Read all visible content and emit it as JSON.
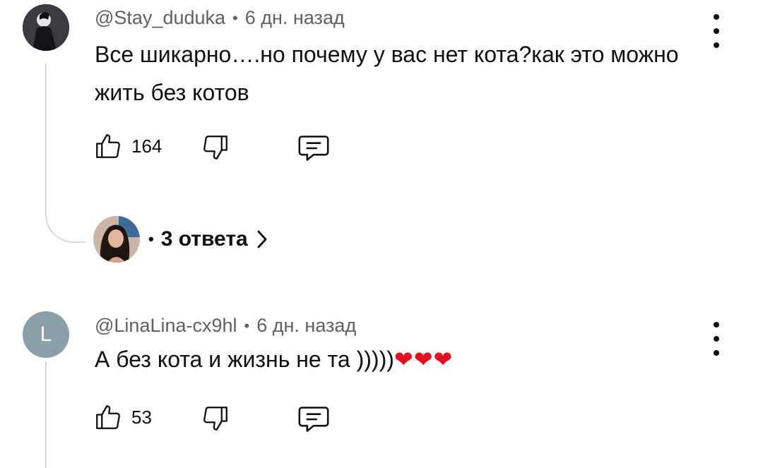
{
  "comments": [
    {
      "author": "@Stay_duduka",
      "time": "6 дн. назад",
      "text_line1": "Все шикарно….но почему у вас нет кота?как это можно",
      "text_line2": "жить без котов",
      "likes": "164",
      "replies_label": "3 ответа"
    },
    {
      "author": "@LinaLina-cx9hl",
      "time": "6 дн. назад",
      "avatar_letter": "L",
      "text": "А без кота и жизнь не та )))))",
      "hearts": "❤❤❤",
      "likes": "53"
    }
  ],
  "meta_separator": "•",
  "colors": {
    "avatar_letter_bg": "#8aa0a8",
    "heart": "#e0101f",
    "meta_text": "#606060"
  }
}
